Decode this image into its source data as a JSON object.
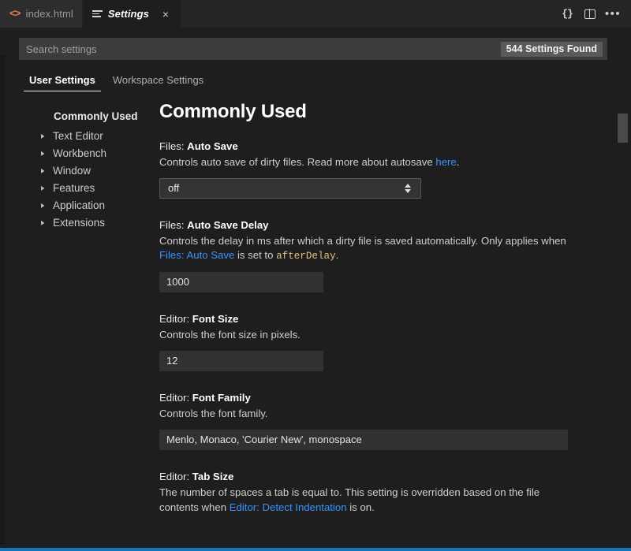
{
  "window": {
    "tabs": [
      {
        "label": "index.html",
        "icon": "html-file-icon",
        "active": false
      },
      {
        "label": "Settings",
        "icon": "settings-lines-icon",
        "active": true,
        "close": "×"
      }
    ],
    "actions": [
      {
        "name": "open-settings-json",
        "glyph": "{}"
      },
      {
        "name": "split-editor",
        "glyph": ""
      },
      {
        "name": "more-actions",
        "glyph": "•••"
      }
    ]
  },
  "search": {
    "placeholder": "Search settings",
    "results_badge": "544 Settings Found"
  },
  "scope_tabs": [
    {
      "label": "User Settings",
      "active": true
    },
    {
      "label": "Workspace Settings",
      "active": false
    }
  ],
  "toc": {
    "header": "Commonly Used",
    "items": [
      {
        "label": "Text Editor"
      },
      {
        "label": "Workbench"
      },
      {
        "label": "Window"
      },
      {
        "label": "Features"
      },
      {
        "label": "Application"
      },
      {
        "label": "Extensions"
      }
    ],
    "chevron": "▸"
  },
  "main": {
    "page_title": "Commonly Used",
    "settings": [
      {
        "prefix": "Files: ",
        "name": "Auto Save",
        "desc_before": "Controls auto save of dirty files. Read more about autosave ",
        "desc_link": "here",
        "desc_after": ".",
        "control": "select",
        "value": "off"
      },
      {
        "prefix": "Files: ",
        "name": "Auto Save Delay",
        "desc_before": "Controls the delay in ms after which a dirty file is saved automatically. Only applies when ",
        "desc_link": "Files: Auto Save",
        "desc_mid": " is set to ",
        "desc_code": "afterDelay",
        "desc_after": ".",
        "control": "input-number",
        "value": "1000"
      },
      {
        "prefix": "Editor: ",
        "name": "Font Size",
        "desc_before": "Controls the font size in pixels.",
        "control": "input-number",
        "value": "12"
      },
      {
        "prefix": "Editor: ",
        "name": "Font Family",
        "desc_before": "Controls the font family.",
        "control": "input-wide",
        "value": "Menlo, Monaco, 'Courier New', monospace"
      },
      {
        "prefix": "Editor: ",
        "name": "Tab Size",
        "desc_before": "The number of spaces a tab is equal to. This setting is overridden based on the file contents when ",
        "desc_link": "Editor: Detect Indentation",
        "desc_after": " is on.",
        "control": "none",
        "value": ""
      }
    ]
  },
  "colors": {
    "accent_link": "#3794ff",
    "code_token": "#e5c07b",
    "status_bar": "#1177bb",
    "html_icon": "#e8804a"
  }
}
